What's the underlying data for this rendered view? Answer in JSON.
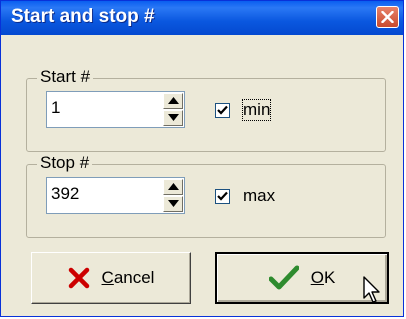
{
  "window": {
    "title": "Start and stop #"
  },
  "start": {
    "group_label": "Start #",
    "value": "1",
    "checkbox_label": "min",
    "checked": true
  },
  "stop": {
    "group_label": "Stop #",
    "value": "392",
    "checkbox_label": "max",
    "checked": true
  },
  "buttons": {
    "cancel": {
      "label_mnemonic": "C",
      "label_rest": "ancel"
    },
    "ok": {
      "label_mnemonic": "O",
      "label_rest": "K"
    }
  },
  "icons": {
    "close": "close-icon",
    "cancel": "x-icon",
    "ok": "check-icon",
    "cursor": "mouse-pointer-icon"
  },
  "colors": {
    "titlebar": "#0a57df",
    "dialog": "#ece9d8",
    "cancel_x": "#cc0000",
    "ok_check": "#2e8b2e"
  }
}
